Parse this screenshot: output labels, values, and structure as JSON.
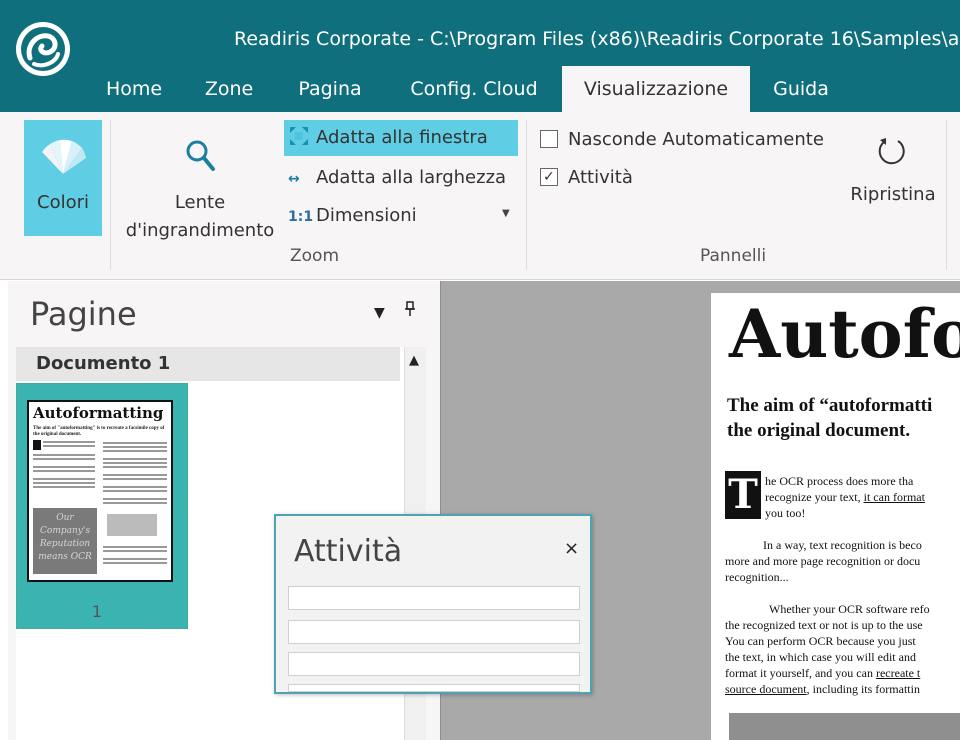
{
  "window": {
    "title": "Readiris Corporate - C:\\Program Files (x86)\\Readiris Corporate 16\\Samples\\au"
  },
  "tabs": [
    {
      "label": "Home"
    },
    {
      "label": "Zone"
    },
    {
      "label": "Pagina"
    },
    {
      "label": "Config. Cloud"
    },
    {
      "label": "Visualizzazione"
    },
    {
      "label": "Guida"
    }
  ],
  "ribbon": {
    "colori_label": "Colori",
    "lente_line1": "Lente",
    "lente_line2": "d'ingrandimento",
    "zoom_items": [
      {
        "icon": "fit-window-icon",
        "label": "Adatta alla finestra"
      },
      {
        "icon": "fit-width-icon",
        "label": "Adatta alla larghezza",
        "glyph": "↔"
      },
      {
        "icon": "actual-size-icon",
        "label": "Dimensioni",
        "glyph": "1:1"
      }
    ],
    "zoom_group_label": "Zoom",
    "panels": {
      "auto_hide_label": "Nasconde Automaticamente",
      "auto_hide_checked": false,
      "activity_label": "Attività",
      "activity_checked": true,
      "check_glyph": "✓"
    },
    "pannelli_group_label": "Pannelli",
    "ripristina_label": "Ripristina"
  },
  "pages_panel": {
    "title": "Pagine",
    "dropdown_glyph": "▼",
    "pin_glyph": "⊥",
    "document_label": "Documento 1",
    "scroll_up_glyph": "▲",
    "thumbnail": {
      "title": "Autoformatting",
      "subtitle": "The aim of \"autoformatting\" is to recreate a facsimile copy of the original document.",
      "image_text": "Our Company's Reputation means OCR",
      "page_number": "1"
    }
  },
  "document": {
    "heading": "Autofo",
    "subheading_line1": "The aim of “autoformatti",
    "subheading_line2": "the original document.",
    "dropcap": "T",
    "p1_line1": "he OCR process does more tha",
    "p1_line2_a": "recognize your text, ",
    "p1_line2_u": "it can format",
    "p1_line3": "you too!",
    "p2_line1": "In a way, text recognition is beco",
    "p2_line2": "more and more page recognition or docu",
    "p2_line3": "recognition...",
    "p3_line1": "Whether your OCR software refo",
    "p3_line2": "the recognized text or not is up to the use",
    "p3_line3": "You can perform OCR because you just",
    "p3_line4": "the text, in which case you will edit and",
    "p3_line5_a": "format it yourself, and you can ",
    "p3_line5_u": "recreate t",
    "p3_line6_u": "source document",
    "p3_line6_b": ", including its formattin"
  },
  "activity_panel": {
    "title": "Attività",
    "close_glyph": "×"
  },
  "colors": {
    "titlebar": "#0f6f7c",
    "accent_highlight": "#5fcde4",
    "thumbnail_bg": "#3ab3b1"
  }
}
